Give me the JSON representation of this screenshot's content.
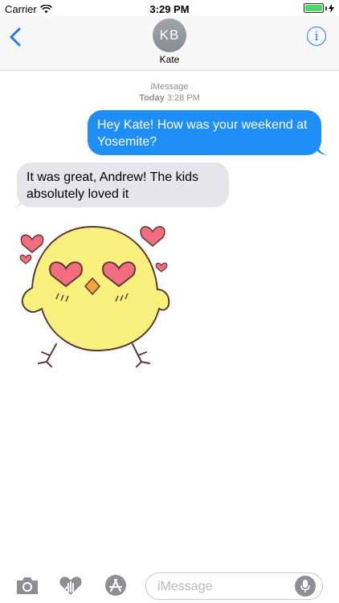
{
  "status_bar": {
    "carrier": "Carrier",
    "time": "3:29 PM",
    "battery_level": 1.0
  },
  "header": {
    "back_icon": "chevron-left-icon",
    "avatar_initials": "KB",
    "contact_name": "Kate",
    "info_icon": "info-icon",
    "info_glyph": "i"
  },
  "conversation": {
    "service": "iMessage",
    "day": "Today",
    "time": "3:28 PM",
    "messages": [
      {
        "sender": "me",
        "text": "Hey Kate! How was your weekend at Yosemite?"
      },
      {
        "sender": "Kate",
        "text": "It was great, Andrew! The kids absolutely loved it"
      }
    ],
    "sticker": "chick-heart-eyes-sticker"
  },
  "compose": {
    "placeholder": "iMessage",
    "camera_icon": "camera-icon",
    "digital_touch_icon": "heart-hand-icon",
    "app_store_icon": "app-store-icon",
    "mic_icon": "microphone-icon"
  },
  "colors": {
    "accent": "#1f7cf5",
    "sent_bubble": "#1f8ef7",
    "received_bubble": "#e5e5ea",
    "battery": "#4cd964"
  }
}
